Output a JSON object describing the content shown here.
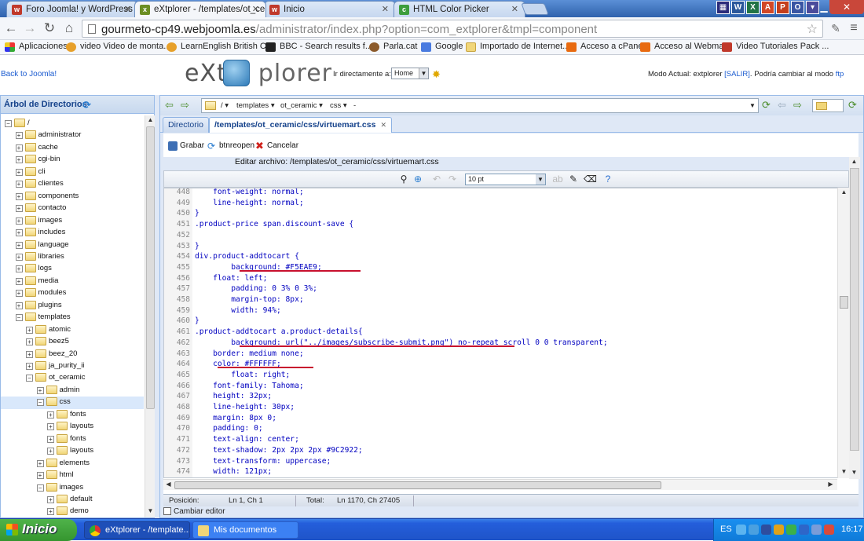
{
  "browser": {
    "tabs": [
      {
        "title": "Foro Joomla! y WordPress ::",
        "icon": "w"
      },
      {
        "title": "eXtplorer - /templates/ot_ce",
        "icon": "x"
      },
      {
        "title": "Inicio",
        "icon": "w"
      },
      {
        "title": "HTML Color Picker",
        "icon": "c"
      }
    ],
    "url_host": "gourmeto-cp49.webjoomla.es",
    "url_path": "/administrator/index.php?option=com_extplorer&tmpl=component",
    "bookmarks": [
      "Aplicaciones",
      "video Video de monta...",
      "LearnEnglish British C...",
      "BBC - Search results f...",
      "Parla.cat",
      "Google",
      "Importado de Internet...",
      "Acceso a cPanel",
      "Acceso al Webmail",
      "Video Tutoriales Pack ..."
    ]
  },
  "header": {
    "back_link": "Back to Joomla!",
    "logo_left": "eXt",
    "logo_right": "plorer",
    "goto_label": "Ir directamente a:",
    "goto_value": "Home",
    "mode_prefix": "Modo Actual: extplorer ",
    "mode_link1": "[SALIR]",
    "mode_mid": ". Podría cambiar al modo ",
    "mode_link2": "ftp"
  },
  "tree": {
    "title": "Árbol de Directorios",
    "items": [
      {
        "label": "/",
        "level": 0,
        "expanded": true
      },
      {
        "label": "administrator",
        "level": 1
      },
      {
        "label": "cache",
        "level": 1
      },
      {
        "label": "cgi-bin",
        "level": 1
      },
      {
        "label": "cli",
        "level": 1
      },
      {
        "label": "clientes",
        "level": 1
      },
      {
        "label": "components",
        "level": 1
      },
      {
        "label": "contacto",
        "level": 1
      },
      {
        "label": "images",
        "level": 1
      },
      {
        "label": "includes",
        "level": 1
      },
      {
        "label": "language",
        "level": 1
      },
      {
        "label": "libraries",
        "level": 1
      },
      {
        "label": "logs",
        "level": 1
      },
      {
        "label": "media",
        "level": 1
      },
      {
        "label": "modules",
        "level": 1
      },
      {
        "label": "plugins",
        "level": 1
      },
      {
        "label": "templates",
        "level": 1,
        "expanded": true
      },
      {
        "label": "atomic",
        "level": 2
      },
      {
        "label": "beez5",
        "level": 2
      },
      {
        "label": "beez_20",
        "level": 2
      },
      {
        "label": "ja_purity_ii",
        "level": 2
      },
      {
        "label": "ot_ceramic",
        "level": 2,
        "expanded": true
      },
      {
        "label": "admin",
        "level": 3
      },
      {
        "label": "css",
        "level": 3,
        "expanded": true,
        "selected": true
      },
      {
        "label": "fonts",
        "level": 4
      },
      {
        "label": "layouts",
        "level": 4
      },
      {
        "label": "fonts",
        "level": 4
      },
      {
        "label": "layouts",
        "level": 4
      },
      {
        "label": "elements",
        "level": 3
      },
      {
        "label": "html",
        "level": 3
      },
      {
        "label": "images",
        "level": 3,
        "expanded": true
      },
      {
        "label": "default",
        "level": 4
      },
      {
        "label": "demo",
        "level": 4
      }
    ]
  },
  "path": {
    "crumbs": [
      "/",
      "templates",
      "ot_ceramic",
      "css",
      "-"
    ]
  },
  "panel_tabs": {
    "directory": "Directorio",
    "file": "/templates/ot_ceramic/css/virtuemart.css"
  },
  "actions": {
    "save": "Grabar",
    "reopen": "btnreopen",
    "cancel": "Cancelar"
  },
  "editor": {
    "edit_label": "Editar archivo: /templates/ot_ceramic/css/virtuemart.css",
    "font_size": "10 pt",
    "lines": [
      {
        "n": "448",
        "t": "    font-weight: normal;"
      },
      {
        "n": "449",
        "t": "    line-height: normal;"
      },
      {
        "n": "450",
        "t": "}"
      },
      {
        "n": "451",
        "t": ".product-price span.discount-save {"
      },
      {
        "n": "452",
        "t": ""
      },
      {
        "n": "453",
        "t": "}"
      },
      {
        "n": "454",
        "t": "div.product-addtocart {"
      },
      {
        "n": "455",
        "t": "        background: #F5EAE9;"
      },
      {
        "n": "456",
        "t": "    float: left;"
      },
      {
        "n": "457",
        "t": "        padding: 0 3% 0 3%;"
      },
      {
        "n": "458",
        "t": "        margin-top: 8px;"
      },
      {
        "n": "459",
        "t": "        width: 94%;"
      },
      {
        "n": "460",
        "t": "}"
      },
      {
        "n": "461",
        "t": ".product-addtocart a.product-details{"
      },
      {
        "n": "462",
        "t": "        background: url(\"../images/subscribe-submit.png\") no-repeat scroll 0 0 transparent;"
      },
      {
        "n": "463",
        "t": "    border: medium none;"
      },
      {
        "n": "464",
        "t": "    color: #FFFFFF;"
      },
      {
        "n": "465",
        "t": "        float: right;"
      },
      {
        "n": "466",
        "t": "    font-family: Tahoma;"
      },
      {
        "n": "467",
        "t": "    height: 32px;"
      },
      {
        "n": "468",
        "t": "    line-height: 30px;"
      },
      {
        "n": "469",
        "t": "    margin: 8px 0;"
      },
      {
        "n": "470",
        "t": "    padding: 0;"
      },
      {
        "n": "471",
        "t": "    text-align: center;"
      },
      {
        "n": "472",
        "t": "    text-shadow: 2px 2px 2px #9C2922;"
      },
      {
        "n": "473",
        "t": "    text-transform: uppercase;"
      },
      {
        "n": "474",
        "t": "    width: 121px;"
      }
    ]
  },
  "status": {
    "pos_label": "Posición:",
    "pos_value": "Ln 1, Ch 1",
    "total_label": "Total:",
    "total_value": "Ln 1170, Ch 27405",
    "change_editor": "Cambiar editor"
  },
  "taskbar": {
    "start": "Inicio",
    "tasks": [
      "eXtplorer - /template...",
      "Mis documentos"
    ],
    "lang": "ES",
    "clock": "16:17"
  },
  "colors": {
    "accent": "#15428b",
    "underline": "#c8102e",
    "link": "#1a5bd0"
  }
}
